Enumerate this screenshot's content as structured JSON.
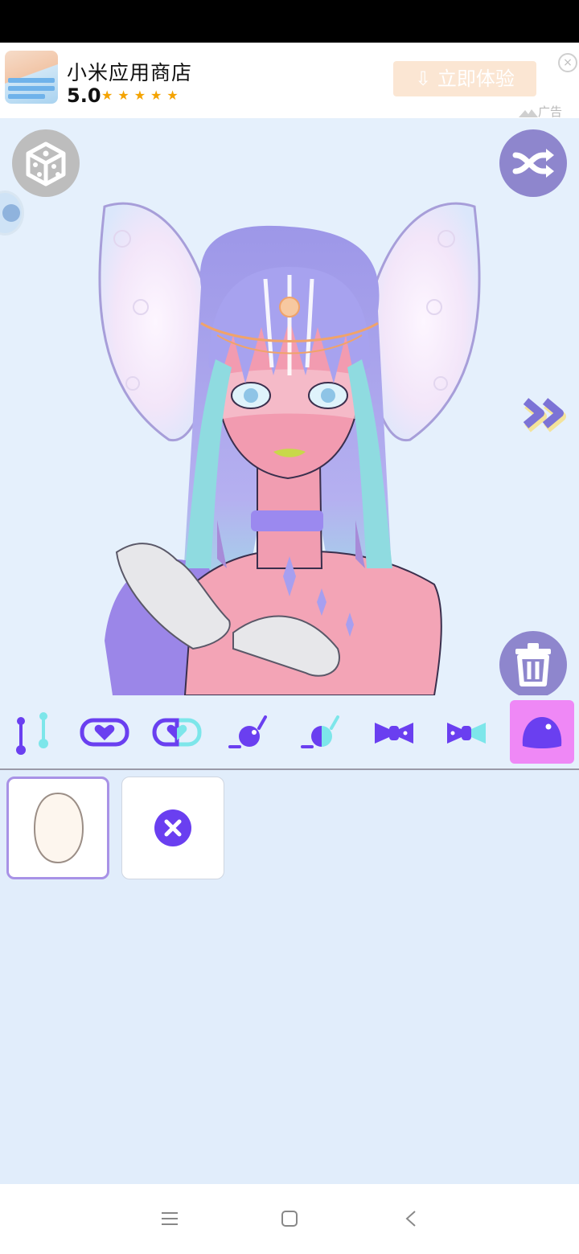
{
  "ad": {
    "title": "小米应用商店",
    "rating": "5.0",
    "stars": "★★★★★",
    "cta": "⇩ 立即体验",
    "tag": "广告",
    "close": "×"
  },
  "stage": {
    "left_button": "dice-icon",
    "right_button": "shuffle-icon",
    "delete_button": "trash-icon",
    "next": "double-chevron-right-icon"
  },
  "toolbar": {
    "tools": [
      "body-shape-icon",
      "heart-badge-icon",
      "half-heart-badge-icon",
      "bauble-icon",
      "half-bauble-icon",
      "bow-icon",
      "half-bow-icon",
      "blob-icon"
    ],
    "selected_index": 7
  },
  "options": {
    "items": [
      "egg-shape-option",
      "none-option"
    ],
    "selected_index": 0
  },
  "colors": {
    "accent_purple": "#6a3ff0",
    "button_purple": "#8e86cd",
    "selected_tool_pink": "#ef88f6",
    "panel_bg": "#e1edfb",
    "cta_bg": "#fbe6d3"
  }
}
